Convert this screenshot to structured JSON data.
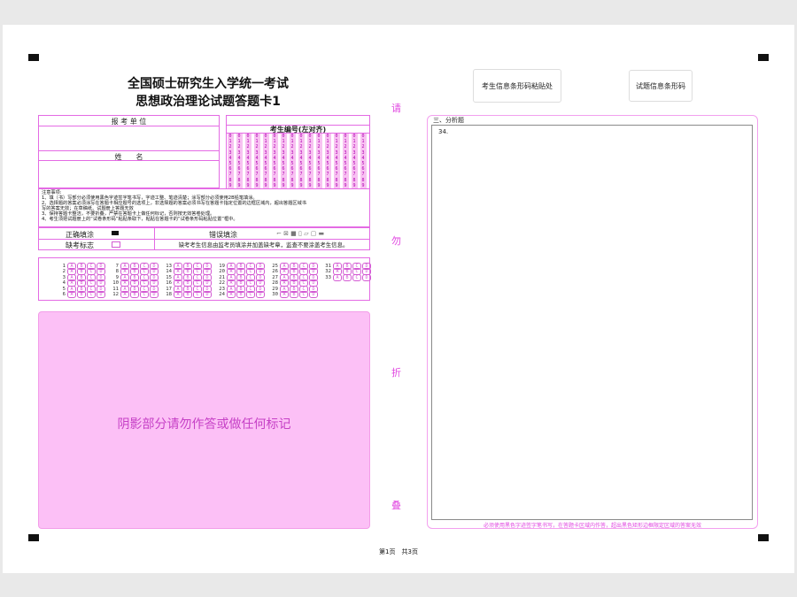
{
  "header": {
    "title_line1": "全国硕士研究生入学统一考试",
    "title_line2": "思想政治理论试题答题卡1"
  },
  "left_form": {
    "exam_unit_label": "报 考 单 位",
    "name_label": "姓　　名",
    "exam_number_label": "考生编号(左对齐)",
    "digits": [
      "0",
      "1",
      "2",
      "3",
      "4",
      "5",
      "6",
      "7",
      "8",
      "9"
    ],
    "notice_title": "注意事项:",
    "notice_lines": [
      "1、填（书）写部分必须使用黑色字迹签字笔书写，字迹工整、笔迹清楚；涂写部分必须使用2B铅笔填涂。",
      "2、选择题的答案必须涂写在答题卡相应题号的选项上，非选择题的答案必须书写在答题卡指定位置的边框区域内，超出答题区域书",
      "写的答案无效；在草稿纸、试题册上答题无效",
      "3、保持答题卡整洁，不要折叠，严禁在答题卡上做任何标记，否则按无效答卷处理。",
      "4、考生须把试题册上的“试卷条形码”粘贴条取下，粘贴在答题卡的“试卷条形码粘贴位置”框中。"
    ],
    "correct_fill_label": "正确填涂",
    "wrong_fill_label": "错误填涂",
    "absent_label": "缺考标志",
    "absent_note": "缺考考生信息由监考员填涂并加盖缺考章，监查不要涂盖考生信息。",
    "shade_text": "阴影部分请勿作答或做任何标记"
  },
  "mcq": {
    "options": [
      "A",
      "B",
      "C",
      "D"
    ],
    "rows": [
      [
        1,
        7,
        13,
        19,
        25,
        31
      ],
      [
        2,
        8,
        14,
        20,
        26,
        32
      ],
      [
        3,
        9,
        15,
        21,
        27,
        33
      ],
      [
        4,
        10,
        16,
        22,
        28
      ],
      [
        5,
        11,
        17,
        23,
        29
      ],
      [
        6,
        12,
        18,
        24,
        30
      ]
    ]
  },
  "fold_text": [
    "请",
    "勿",
    "折",
    "叠"
  ],
  "right": {
    "barcode_label_1": "考生信息条形码粘贴处",
    "barcode_label_2": "试题信息条形码",
    "section_title": "三、分析题",
    "question_no": "34.",
    "bottom_note": "必须使用黑色字迹签字笔书写，在答题卡区域内作答，超出黑色矩形边框限定区域的答案无效"
  },
  "footer": {
    "page_info": "第1页　共3页"
  },
  "colors": {
    "accent": "#e046e0",
    "shade": "#fcc0f6"
  }
}
